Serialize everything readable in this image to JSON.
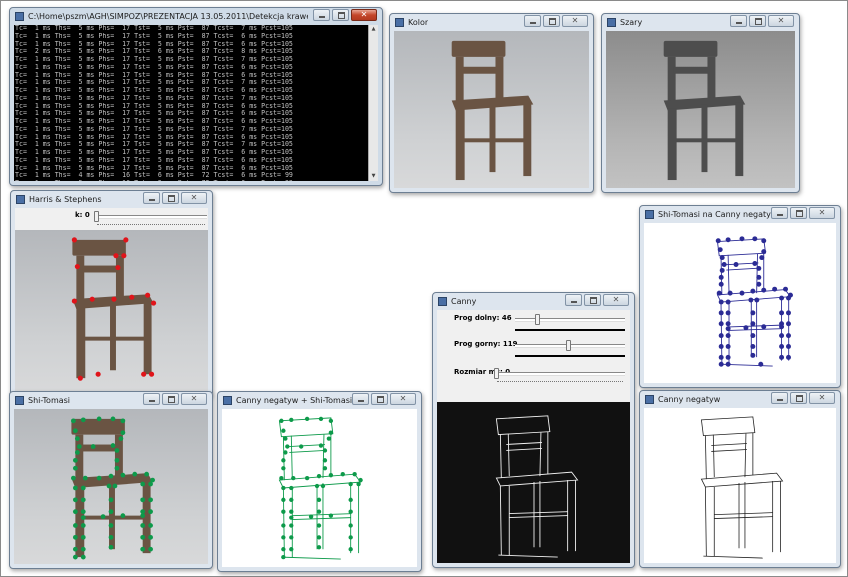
{
  "console": {
    "title": "C:\\Home\\pszm\\AGH\\SIMPOZ\\PREZENTACJA 13.05.2011\\Detekcja krawędzi i wierzchołków\\dkdw.e...",
    "lines": [
      "Tc=  1 ms Ths=  5 ms Phs=  17 Tst=  5 ms Pst=  87 Tcst=  7 ms Pcst=105",
      "Tc=  1 ms Ths=  5 ms Phs=  17 Tst=  5 ms Pst=  87 Tcst=  6 ms Pcst=105",
      "Tc=  1 ms Ths=  5 ms Phs=  17 Tst=  5 ms Pst=  87 Tcst=  6 ms Pcst=105",
      "Tc=  2 ms Ths=  5 ms Phs=  17 Tst=  6 ms Pst=  87 Tcst=  8 ms Pcst=105",
      "Tc=  1 ms Ths=  5 ms Phs=  17 Tst=  5 ms Pst=  87 Tcst=  7 ms Pcst=105",
      "Tc=  1 ms Ths=  5 ms Phs=  17 Tst=  5 ms Pst=  87 Tcst=  6 ms Pcst=105",
      "Tc=  1 ms Ths=  5 ms Phs=  17 Tst=  5 ms Pst=  87 Tcst=  6 ms Pcst=105",
      "Tc=  1 ms Ths=  5 ms Phs=  17 Tst=  5 ms Pst=  87 Tcst=  7 ms Pcst=105",
      "Tc=  1 ms Ths=  5 ms Phs=  17 Tst=  5 ms Pst=  87 Tcst=  6 ms Pcst=105",
      "Tc=  1 ms Ths=  5 ms Phs=  17 Tst=  5 ms Pst=  87 Tcst=  7 ms Pcst=105",
      "Tc=  1 ms Ths=  5 ms Phs=  17 Tst=  5 ms Pst=  87 Tcst=  6 ms Pcst=105",
      "Tc=  1 ms Ths=  5 ms Phs=  17 Tst=  5 ms Pst=  87 Tcst=  6 ms Pcst=105",
      "Tc=  1 ms Ths=  5 ms Phs=  17 Tst=  5 ms Pst=  87 Tcst=  6 ms Pcst=105",
      "Tc=  1 ms Ths=  5 ms Phs=  17 Tst=  5 ms Pst=  87 Tcst=  7 ms Pcst=105",
      "Tc=  1 ms Ths=  5 ms Phs=  17 Tst=  5 ms Pst=  87 Tcst=  6 ms Pcst=105",
      "Tc=  1 ms Ths=  5 ms Phs=  17 Tst=  5 ms Pst=  87 Tcst=  7 ms Pcst=105",
      "Tc=  1 ms Ths=  5 ms Phs=  17 Tst=  5 ms Pst=  87 Tcst=  6 ms Pcst=105",
      "Tc=  1 ms Ths=  5 ms Phs=  17 Tst=  5 ms Pst=  87 Tcst=  6 ms Pcst=105",
      "Tc=  1 ms Ths=  5 ms Phs=  17 Tst=  5 ms Pst=  87 Tcst=  6 ms Pcst=105",
      "Tc=  1 ms Ths=  4 ms Phs=  16 Tst=  6 ms Pst=  72 Tcst=  6 ms Pcst= 99",
      "Tc=  1 ms Ths=  5 ms Phs=  16 Tst=  5 ms Pst=  72 Tcst=  6 ms Pcst= 99",
      "Tc=  1 ms Ths=  5 ms Phs=  16"
    ]
  },
  "windows": {
    "kolor": {
      "title": "Kolor"
    },
    "szary": {
      "title": "Szary"
    },
    "harris": {
      "title": "Harris & Stephens",
      "slider_label": "k: 0"
    },
    "shitomasi_canny": {
      "title": "Shi-Tomasi na Canny negatyw"
    },
    "canny": {
      "title": "Canny",
      "low_label": "Prog dolny: 46",
      "high_label": "Prog gorny: 119",
      "size_label": "Rozmiar ms: 0"
    },
    "shitomasi": {
      "title": "Shi-Tomasi"
    },
    "canny_neg_shi": {
      "title": "Canny negatyw + Shi-Tomasi"
    },
    "canny_neg": {
      "title": "Canny negatyw"
    }
  },
  "icons": {
    "window": "app-window-icon",
    "minimize": "minimize-icon",
    "maximize": "maximize-icon",
    "close": "close-icon"
  },
  "colors": {
    "harris_points": "#e0141a",
    "shi_tomasi_points": "#0d9a4a",
    "shi_tomasi_canny_points": "#2b2b95",
    "canny_bg": "#111111"
  },
  "sliders": {
    "canny_low": 46,
    "canny_high": 119,
    "canny_size": 0,
    "harris_k": 0
  },
  "glyphs": {
    "close": "✕",
    "scroll_up": "▲",
    "scroll_down": "▼"
  }
}
